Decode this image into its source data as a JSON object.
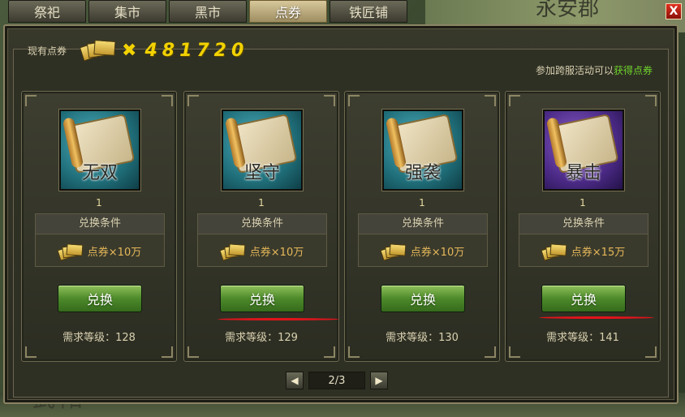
{
  "tabs": [
    "祭祀",
    "集市",
    "黑市",
    "点券",
    "铁匠铺"
  ],
  "active_tab": 3,
  "close_label": "X",
  "background": {
    "title_text": "永安郡",
    "bottom_text": "武阳"
  },
  "currency": {
    "label": "现有点券",
    "times": "✖",
    "value": "481720"
  },
  "event": {
    "prefix": "参加跨服活动可以",
    "link": "获得点券"
  },
  "cards": [
    {
      "icon_label": "无双",
      "icon_style": "teal-scroll",
      "count": "1",
      "cond_title": "兑换条件",
      "cost": "点券×10万",
      "button": "兑换",
      "req_level": "需求等级：128"
    },
    {
      "icon_label": "坚守",
      "icon_style": "teal-scroll",
      "count": "1",
      "cond_title": "兑换条件",
      "cost": "点券×10万",
      "button": "兑换",
      "req_level": "需求等级：129"
    },
    {
      "icon_label": "强袭",
      "icon_style": "teal-scroll",
      "count": "1",
      "cond_title": "兑换条件",
      "cost": "点券×10万",
      "button": "兑换",
      "req_level": "需求等级：130"
    },
    {
      "icon_label": "暴击",
      "icon_style": "purple-scroll",
      "count": "1",
      "cond_title": "兑换条件",
      "cost": "点券×15万",
      "button": "兑换",
      "req_level": "需求等级：141"
    }
  ],
  "pager": {
    "prev": "◀",
    "text": "2/3",
    "next": "▶"
  },
  "colors": {
    "gold": "#f2d200",
    "green_link": "#6fd42c",
    "red_mark": "#e0141c"
  }
}
